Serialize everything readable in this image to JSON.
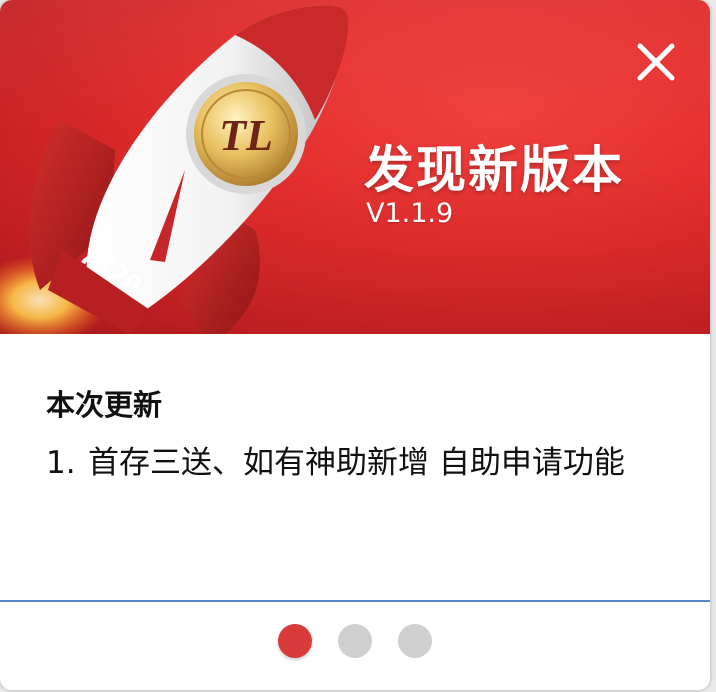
{
  "banner": {
    "title": "发现新版本",
    "version": "V1.1.9",
    "rocket_badge": "7520",
    "logo_monogram": "TL"
  },
  "content": {
    "heading": "本次更新",
    "notes": [
      {
        "index": "1.",
        "text": "首存三送、如有神助新增 自助申请功能"
      }
    ]
  },
  "pager": {
    "page_count": 3,
    "active_page": 1
  },
  "colors": {
    "banner_red": "#e12b2b",
    "dot_active": "#d93a3a",
    "dot_inactive": "#cfcfcf",
    "divider": "#5a86c9"
  },
  "icons": {
    "close": "close-icon",
    "rocket": "rocket-illustration"
  }
}
